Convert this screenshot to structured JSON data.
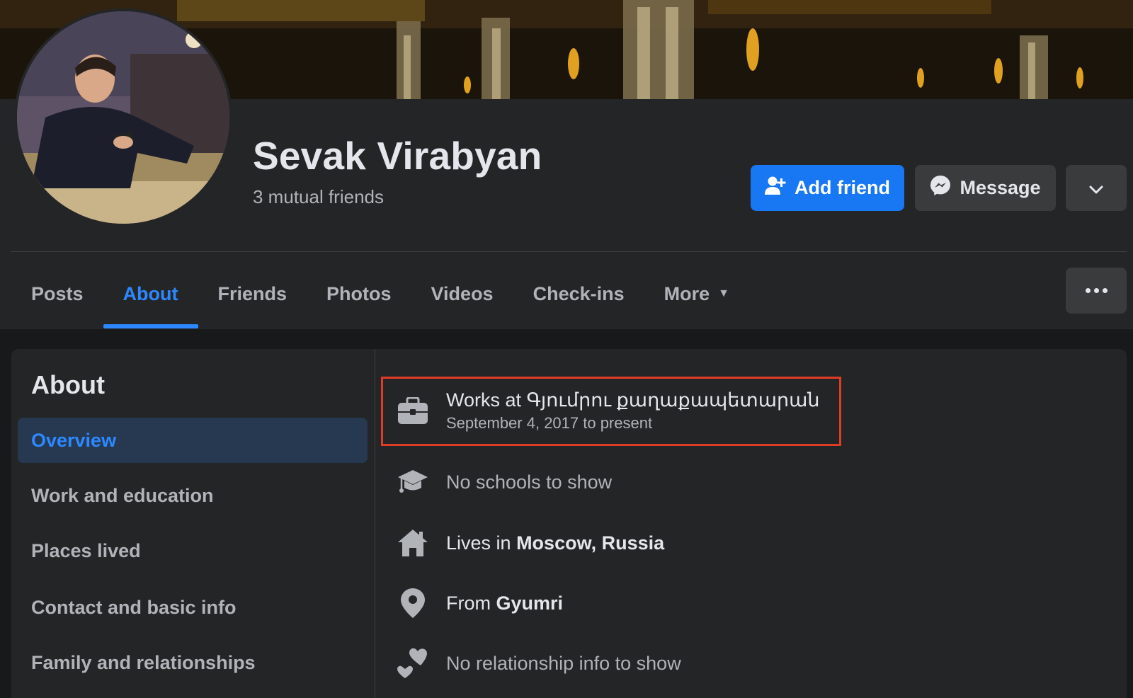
{
  "profile": {
    "name": "Sevak Virabyan",
    "mutual_friends": "3 mutual friends"
  },
  "actions": {
    "add_friend": "Add friend",
    "message": "Message"
  },
  "tabs": [
    "Posts",
    "About",
    "Friends",
    "Photos",
    "Videos",
    "Check-ins",
    "More"
  ],
  "about": {
    "title": "About",
    "nav": [
      "Overview",
      "Work and education",
      "Places lived",
      "Contact and basic info",
      "Family and relationships"
    ],
    "work": {
      "prefix": "Works at ",
      "place": "Գյումրու քաղաքապետարան",
      "dates": "September 4, 2017 to present"
    },
    "schools": "No schools to show",
    "lives": {
      "prefix": "Lives in ",
      "place": "Moscow, Russia"
    },
    "from": {
      "prefix": "From ",
      "place": "Gyumri"
    },
    "relationship": "No relationship info to show"
  },
  "colors": {
    "accent": "#1877f2",
    "active_tab": "#2d88ff",
    "highlight_border": "#e03b24",
    "background": "#18191a",
    "card": "#242526"
  },
  "icons": [
    "user-plus-icon",
    "messenger-icon",
    "chevron-down-icon",
    "ellipsis-icon",
    "briefcase-icon",
    "graduation-cap-icon",
    "home-icon",
    "location-pin-icon",
    "hearts-icon",
    "caret-down-icon"
  ]
}
